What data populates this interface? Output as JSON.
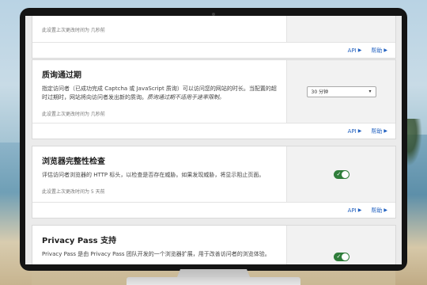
{
  "cards": [
    {
      "meta": "此设置上次更改时间为 几秒前",
      "api_label": "API",
      "help_label": "帮助"
    },
    {
      "title": "质询通过期",
      "description": "指定访问者（已成功完成 Captcha 或 JavaScript 质询）可以访问您的网站的时长。当配置的超时过期时，网站将向访问者发出新的质询。",
      "description_italic": "质询通过期不适用于速率限制。",
      "meta": "此设置上次更改时间为 几秒前",
      "select_value": "30 分钟",
      "api_label": "API",
      "help_label": "帮助"
    },
    {
      "title": "浏览器完整性检查",
      "description": "评估访问者浏览器的 HTTP 标头，以检查是否存在威胁。如果发现威胁，将显示阻止页面。",
      "meta": "此设置上次更改时间为 5 天前",
      "toggle_on": true,
      "api_label": "API",
      "help_label": "帮助"
    },
    {
      "title": "Privacy Pass 支持",
      "description": "Privacy Pass 是由 Privacy Pass 团队开发的一个浏览器扩展，用于改善访问者的浏览体验。",
      "toggle_on": true
    }
  ],
  "colors": {
    "link": "#1f5fbf",
    "toggle_on": "#2f7d3a"
  }
}
